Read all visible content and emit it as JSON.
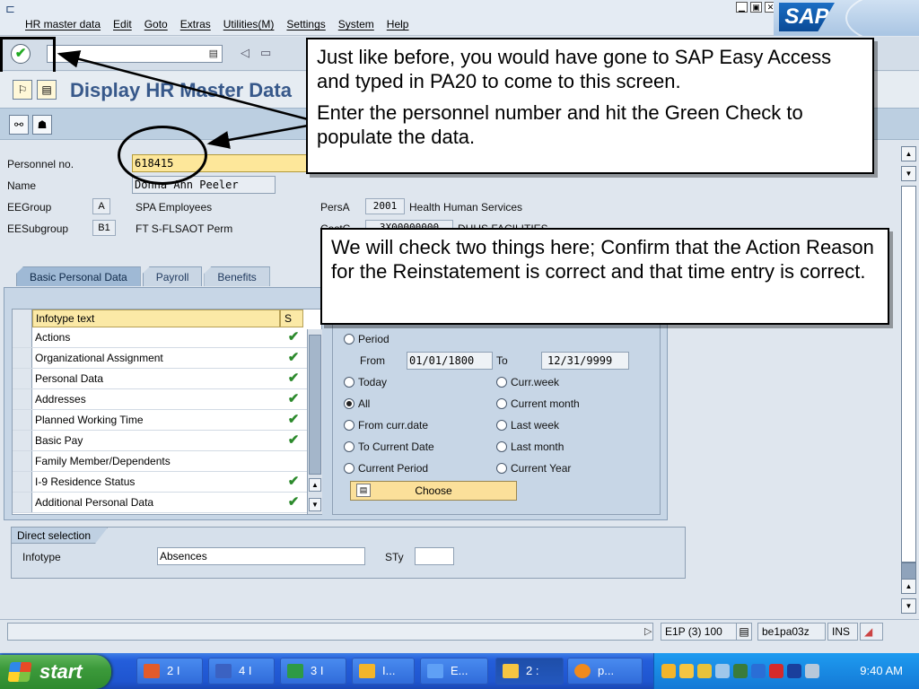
{
  "menu": {
    "items": [
      "HR master data",
      "Edit",
      "Goto",
      "Extras",
      "Utilities(M)",
      "Settings",
      "System",
      "Help"
    ]
  },
  "brand": {
    "logo": "SAP"
  },
  "title": "Display HR Master Data",
  "header": {
    "personnel_label": "Personnel no.",
    "personnel_value": "618415",
    "name_label": "Name",
    "name_value": "Donna Ann Peeler",
    "eegroup_label": "EEGroup",
    "eegroup_code": "A",
    "eegroup_text": "SPA Employees",
    "eesubgroup_label": "EESubgroup",
    "eesubgroup_code": "B1",
    "eesubgroup_text": "FT S-FLSAOT Perm",
    "persa_label": "PersA",
    "persa_code": "2001",
    "persa_text": "Health Human Services",
    "costc_label": "CostC",
    "costc_code": "3X00000000",
    "costc_text": "DHHS FACILITIES"
  },
  "tabs": [
    "Basic Personal Data",
    "Payroll",
    "Benefits"
  ],
  "infotypes": {
    "col_text": "Infotype text",
    "col_s": "S",
    "rows": [
      {
        "text": "Actions",
        "check": "✔"
      },
      {
        "text": "Organizational Assignment",
        "check": "✔"
      },
      {
        "text": "Personal Data",
        "check": "✔"
      },
      {
        "text": "Addresses",
        "check": "✔"
      },
      {
        "text": "Planned Working Time",
        "check": "✔"
      },
      {
        "text": "Basic Pay",
        "check": "✔"
      },
      {
        "text": "Family Member/Dependents",
        "check": ""
      },
      {
        "text": "I-9 Residence Status",
        "check": "✔"
      },
      {
        "text": "Additional Personal Data",
        "check": "✔"
      }
    ]
  },
  "period": {
    "period_label": "Period",
    "from_label": "From",
    "from_value": "01/01/1800",
    "to_label": "To",
    "to_value": "12/31/9999",
    "today": "Today",
    "curr_week": "Curr.week",
    "all": "All",
    "current_month": "Current month",
    "from_curr_date": "From curr.date",
    "last_week": "Last week",
    "to_current_date": "To Current Date",
    "last_month": "Last month",
    "current_period": "Current Period",
    "current_year": "Current Year",
    "choose": "Choose"
  },
  "direct": {
    "caption": "Direct selection",
    "infotype_label": "Infotype",
    "infotype_value": "Absences",
    "sty_label": "STy",
    "sty_value": ""
  },
  "status": {
    "system": "E1P (3) 100",
    "server": "be1pa03z",
    "mode": "INS"
  },
  "taskbar": {
    "start": "start",
    "buttons": [
      "2 I",
      "4 I",
      "3 I",
      "I...",
      "E...",
      "2 :",
      "p..."
    ],
    "clock": "9:40 AM"
  },
  "callouts": {
    "top_p1": "Just like before, you would have gone to SAP Easy Access and typed in PA20 to come to this screen.",
    "top_p2": "Enter the personnel number and hit the Green Check to populate the data.",
    "mid": "We will check two things here; Confirm that the Action Reason for the Reinstatement is correct and that time entry is correct."
  }
}
